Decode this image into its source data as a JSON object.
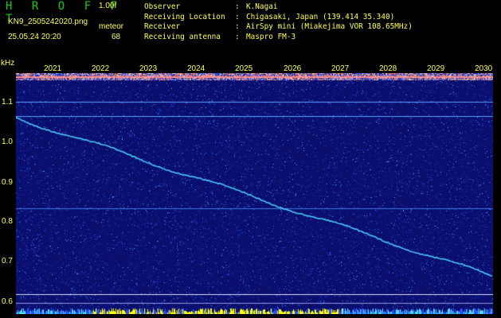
{
  "header": {
    "brand": "H R O F F T",
    "version": "1.00f",
    "filename": "KN9_2505242020.png",
    "meteor_label": "meteor",
    "datetime": "25.05.24 20:20",
    "count": "68"
  },
  "info": [
    {
      "key": "Observer",
      "sep": ":",
      "value": "K.Nagai"
    },
    {
      "key": "Receiving Location",
      "sep": ":",
      "value": "Chigasaki, Japan (139.414 35.340)"
    },
    {
      "key": "Receiver",
      "sep": ":",
      "value": "AirSpy mini (Miakejima VOR 108.65MHz)"
    },
    {
      "key": "Receiving antenna",
      "sep": ":",
      "value": "Maspro FM-3"
    }
  ],
  "axis": {
    "unit": "kHz",
    "y_ticks": [
      "1.1",
      "1.0",
      "0.9",
      "0.8",
      "0.7",
      "0.6"
    ],
    "x_ticks": [
      "2021",
      "2022",
      "2023",
      "2024",
      "2025",
      "2026",
      "2027",
      "2028",
      "2029",
      "2030"
    ]
  },
  "colors": {
    "background": "#000000",
    "plot_background": "#0a0f6e",
    "text": "#ffff5a",
    "brand": "#19c819",
    "trace": "#4fd0ff",
    "noise_bar": "#ffff00"
  }
}
